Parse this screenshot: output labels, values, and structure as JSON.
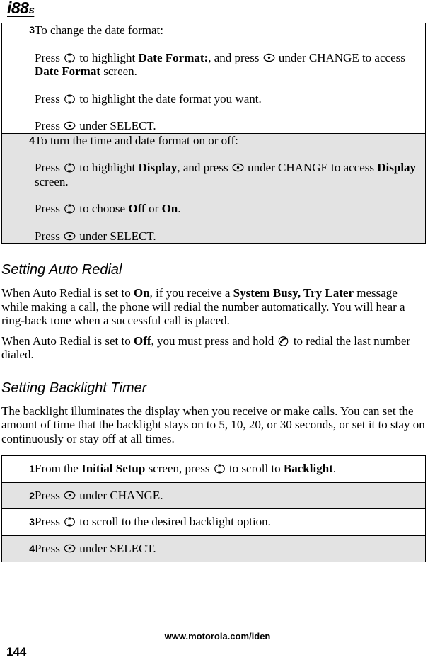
{
  "header": {
    "model_main": "i88",
    "model_sub": "s"
  },
  "icons": {
    "scroll_key": "scroll-navigation-key-icon",
    "select_key": "center-select-key-icon",
    "send_key": "send-call-key-icon"
  },
  "date_format_table": {
    "rows": [
      {
        "number": "3",
        "shaded": false,
        "paragraphs": [
          [
            {
              "t": "text",
              "v": "To change the date format:"
            }
          ],
          [
            {
              "t": "text",
              "v": "Press "
            },
            {
              "t": "icon",
              "v": "scroll_key"
            },
            {
              "t": "text",
              "v": " to highlight "
            },
            {
              "t": "bold",
              "v": "Date Format:"
            },
            {
              "t": "text",
              "v": ", and press "
            },
            {
              "t": "icon",
              "v": "select_key"
            },
            {
              "t": "text",
              "v": " under CHANGE to access "
            },
            {
              "t": "bold",
              "v": "Date Format"
            },
            {
              "t": "text",
              "v": " screen."
            }
          ],
          [
            {
              "t": "text",
              "v": "Press "
            },
            {
              "t": "icon",
              "v": "scroll_key"
            },
            {
              "t": "text",
              "v": " to highlight the date format you want."
            }
          ],
          [
            {
              "t": "text",
              "v": "Press "
            },
            {
              "t": "icon",
              "v": "select_key"
            },
            {
              "t": "text",
              "v": " under SELECT."
            }
          ]
        ]
      },
      {
        "number": "4",
        "shaded": true,
        "paragraphs": [
          [
            {
              "t": "text",
              "v": "To turn the time and date format on or off:"
            }
          ],
          [
            {
              "t": "text",
              "v": "Press "
            },
            {
              "t": "icon",
              "v": "scroll_key"
            },
            {
              "t": "text",
              "v": " to highlight "
            },
            {
              "t": "bold",
              "v": "Display"
            },
            {
              "t": "text",
              "v": ", and press "
            },
            {
              "t": "icon",
              "v": "select_key"
            },
            {
              "t": "text",
              "v": " under CHANGE to access "
            },
            {
              "t": "bold",
              "v": "Display"
            },
            {
              "t": "text",
              "v": " screen."
            }
          ],
          [
            {
              "t": "text",
              "v": "Press "
            },
            {
              "t": "icon",
              "v": "scroll_key"
            },
            {
              "t": "text",
              "v": " to choose "
            },
            {
              "t": "bold",
              "v": "Off"
            },
            {
              "t": "text",
              "v": " or "
            },
            {
              "t": "bold",
              "v": "On"
            },
            {
              "t": "text",
              "v": "."
            }
          ],
          [
            {
              "t": "text",
              "v": "Press "
            },
            {
              "t": "icon",
              "v": "select_key"
            },
            {
              "t": "text",
              "v": " under SELECT."
            }
          ]
        ]
      }
    ]
  },
  "auto_redial": {
    "title": "Setting Auto Redial",
    "paragraphs": [
      [
        {
          "t": "text",
          "v": "When Auto Redial is set to "
        },
        {
          "t": "bold",
          "v": "On"
        },
        {
          "t": "text",
          "v": ", if you receive a "
        },
        {
          "t": "bold",
          "v": "System Busy, Try Later"
        },
        {
          "t": "text",
          "v": " message while making a call, the phone will redial the number automatically. You will hear a ring-back tone when a successful call is placed."
        }
      ],
      [
        {
          "t": "text",
          "v": "When Auto Redial is set to "
        },
        {
          "t": "bold",
          "v": "Off"
        },
        {
          "t": "text",
          "v": ", you must press and hold "
        },
        {
          "t": "icon",
          "v": "send_key"
        },
        {
          "t": "text",
          "v": " to redial the last number dialed."
        }
      ]
    ]
  },
  "backlight_timer": {
    "title": "Setting Backlight Timer",
    "paragraphs": [
      [
        {
          "t": "text",
          "v": "The backlight illuminates the display when you receive or make calls. You can set the amount of time that the backlight stays on to 5, 10, 20, or 30 seconds, or set it to stay on continuously or stay off at all times."
        }
      ]
    ],
    "table": {
      "rows": [
        {
          "number": "1",
          "shaded": false,
          "paragraphs": [
            [
              {
                "t": "text",
                "v": "From the "
              },
              {
                "t": "bold",
                "v": "Initial Setup"
              },
              {
                "t": "text",
                "v": " screen, press "
              },
              {
                "t": "icon",
                "v": "scroll_key"
              },
              {
                "t": "text",
                "v": " to scroll to "
              },
              {
                "t": "bold",
                "v": "Backlight"
              },
              {
                "t": "text",
                "v": "."
              }
            ]
          ]
        },
        {
          "number": "2",
          "shaded": true,
          "paragraphs": [
            [
              {
                "t": "text",
                "v": "Press "
              },
              {
                "t": "icon",
                "v": "select_key"
              },
              {
                "t": "text",
                "v": " under CHANGE."
              }
            ]
          ]
        },
        {
          "number": "3",
          "shaded": false,
          "paragraphs": [
            [
              {
                "t": "text",
                "v": "Press "
              },
              {
                "t": "icon",
                "v": "scroll_key"
              },
              {
                "t": "text",
                "v": " to scroll to the desired backlight option."
              }
            ]
          ]
        },
        {
          "number": "4",
          "shaded": true,
          "paragraphs": [
            [
              {
                "t": "text",
                "v": "Press "
              },
              {
                "t": "icon",
                "v": "select_key"
              },
              {
                "t": "text",
                "v": " under SELECT."
              }
            ]
          ]
        }
      ]
    }
  },
  "footer": {
    "url": "www.motorola.com/iden",
    "page_number": "144"
  },
  "colors": {
    "shaded_row": "#e3e3e3",
    "border": "#000000",
    "text": "#000000"
  }
}
